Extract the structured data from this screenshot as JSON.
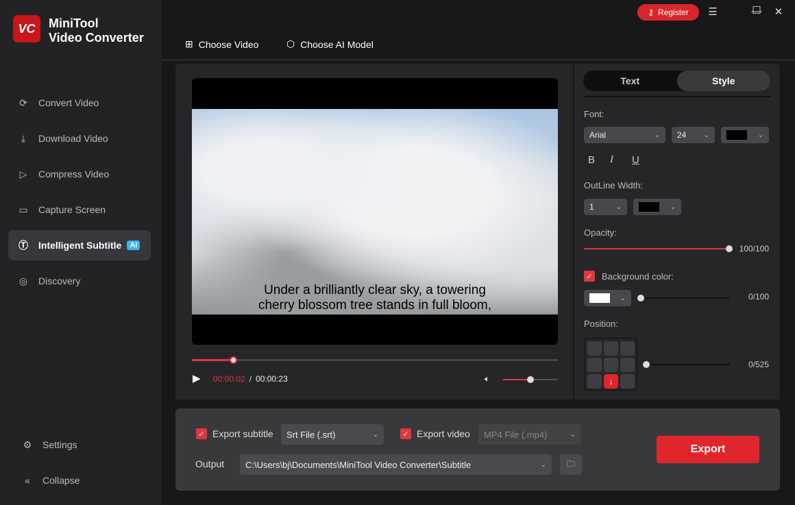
{
  "app": {
    "brand_line1": "MiniTool",
    "brand_line2": "Video Converter",
    "logo_text": "VC"
  },
  "sidebar": {
    "items": [
      {
        "label": "Convert Video"
      },
      {
        "label": "Download Video"
      },
      {
        "label": "Compress Video"
      },
      {
        "label": "Capture Screen"
      },
      {
        "label": "Intelligent Subtitle",
        "badge": "AI"
      },
      {
        "label": "Discovery"
      }
    ],
    "settings": "Settings",
    "collapse": "Collapse"
  },
  "topbar": {
    "register": "Register",
    "choose_video": "Choose Video",
    "choose_ai_model": "Choose AI Model"
  },
  "player": {
    "subtitle_line1": "Under a brilliantly clear sky, a towering",
    "subtitle_line2": "cherry blossom tree stands in full bloom,",
    "current_time": "00:00:02",
    "separator": "/",
    "total_time": "00:00:23",
    "progress": 0.11,
    "volume": 0.5
  },
  "style_panel": {
    "tabs": [
      "Text",
      "Style"
    ],
    "active_tab": "Style",
    "font_label": "Font:",
    "font": "Arial",
    "font_size": "24",
    "font_color": "#000000",
    "bold": "B",
    "italic": "I",
    "underline": "U",
    "outline_label": "OutLine Width:",
    "outline_width": "1",
    "outline_color": "#000000",
    "opacity_label": "Opacity:",
    "opacity_value": "100/100",
    "bg_label": "Background color:",
    "bg_checked": true,
    "bg_color": "#ffffff",
    "bg_value": "0/100",
    "position_label": "Position:",
    "position_value": "0/525",
    "position_selected": "bottom-center"
  },
  "export": {
    "export_subtitle_label": "Export subtitle",
    "subtitle_format": "Srt File (.srt)",
    "export_video_label": "Export video",
    "video_format": "MP4 File (.mp4)",
    "output_label": "Output",
    "output_path": "C:\\Users\\bj\\Documents\\MiniTool Video Converter\\Subtitle",
    "export_button": "Export"
  },
  "colors": {
    "accent": "#e0262c",
    "ai_badge": "#3bb3f0"
  }
}
